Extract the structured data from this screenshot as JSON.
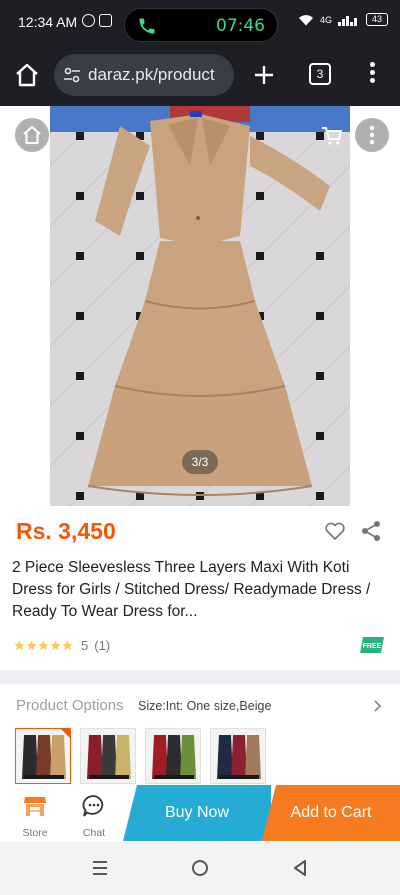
{
  "status_bar": {
    "time": "12:34 AM",
    "call_timer": "07:46",
    "signal": "4G",
    "battery": "43"
  },
  "browser": {
    "url": "daraz.pk/product",
    "tab_count": "3"
  },
  "gallery": {
    "counter": "3/3"
  },
  "product": {
    "price": "Rs. 3,450",
    "title": "2 Piece Sleevesless Three Layers Maxi With Koti Dress for Girls / Stitched Dress/ Readymade Dress / Ready To Wear Dress for...",
    "rating_value": "5",
    "rating_count": "(1)",
    "stars": 5,
    "free_badge": "FREE"
  },
  "options": {
    "label": "Product Options",
    "value": "Size:Int: One size,Beige",
    "thumbnail_count": 4
  },
  "action_bar": {
    "store_label": "Store",
    "chat_label": "Chat",
    "buy_now_label": "Buy Now",
    "add_to_cart_label": "Add to Cart"
  },
  "colors": {
    "price": "#f85606",
    "buy_now": "#26abd4",
    "add_to_cart": "#f57a20",
    "call_timer": "#3ddc84"
  }
}
